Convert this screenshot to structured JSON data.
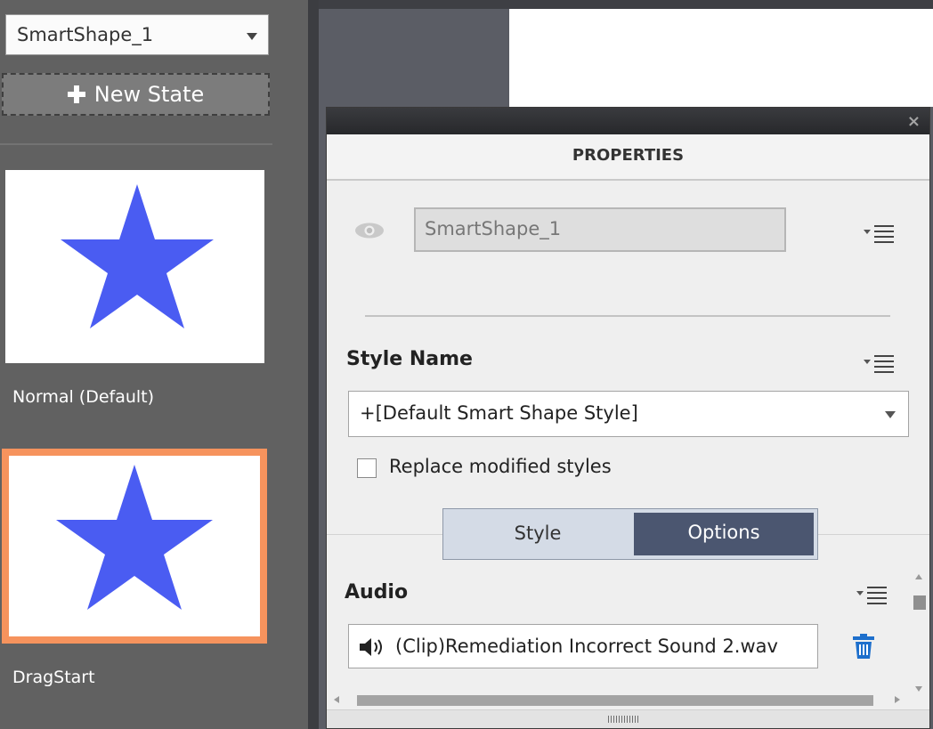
{
  "left_panel": {
    "shape_select": {
      "value": "SmartShape_1"
    },
    "new_state_label": "New State",
    "states": [
      {
        "label": "Normal (Default)",
        "selected": false
      },
      {
        "label": "DragStart",
        "selected": true
      }
    ],
    "star_color": "#4a5cf2",
    "selected_border_color": "#f6935d"
  },
  "properties": {
    "title": "PROPERTIES",
    "item_name": "SmartShape_1",
    "style_name_label": "Style Name",
    "style_value": "+[Default Smart Shape Style]",
    "replace_label": "Replace modified styles",
    "replace_checked": false,
    "tabs": [
      {
        "label": "Style",
        "active": false
      },
      {
        "label": "Options",
        "active": true
      }
    ],
    "audio_label": "Audio",
    "audio_clip": "(Clip)Remediation Incorrect Sound 2.wav"
  },
  "icons": [
    "eye-icon",
    "panel-menu-icon",
    "speaker-icon",
    "trash-icon",
    "close-icon",
    "plus-icon"
  ],
  "colors": {
    "tab_active": "#4b5670",
    "accent_blue": "#1d6fcc"
  }
}
